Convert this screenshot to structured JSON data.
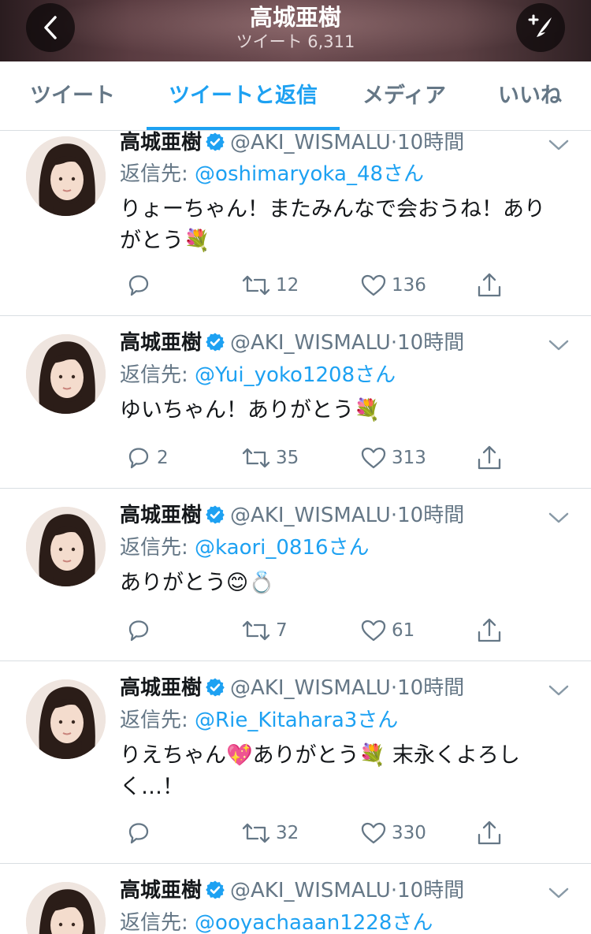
{
  "header": {
    "title": "高城亜樹",
    "tweet_count": "ツイート 6,311",
    "back_icon": "chevron-left-icon",
    "compose_icon": "compose-feather-icon"
  },
  "tabs": [
    {
      "label": "ツイート",
      "active": false
    },
    {
      "label": "ツイートと返信",
      "active": true
    },
    {
      "label": "メディア",
      "active": false
    },
    {
      "label": "いいね",
      "active": false
    }
  ],
  "colors": {
    "accent": "#1da1f2",
    "text": "#14171a",
    "muted": "#657786",
    "divider": "#d9dee2"
  },
  "tweets": [
    {
      "name": "高城亜樹",
      "handle": "@AKI_WISMALU",
      "dot": "·",
      "time": "10時間",
      "reply_prefix": "返信先: ",
      "reply_mention": "@oshimaryoka_48さん",
      "text_line1": "りょーちゃん！またみんなで会おうね！あり",
      "text_line2": "がとう",
      "emoji_end": "💐",
      "reply_count": "",
      "retweet_count": "12",
      "like_count": "136"
    },
    {
      "name": "高城亜樹",
      "handle": "@AKI_WISMALU",
      "dot": "·",
      "time": "10時間",
      "reply_prefix": "返信先: ",
      "reply_mention": "@Yui_yoko1208さん",
      "text_line1": "ゆいちゃん！ありがとう",
      "emoji_end": "💐",
      "reply_count": "2",
      "retweet_count": "35",
      "like_count": "313"
    },
    {
      "name": "高城亜樹",
      "handle": "@AKI_WISMALU",
      "dot": "·",
      "time": "10時間",
      "reply_prefix": "返信先: ",
      "reply_mention": "@kaori_0816さん",
      "text_line1": "ありがとう",
      "emoji_a": "😊",
      "emoji_b": "💍",
      "reply_count": "",
      "retweet_count": "7",
      "like_count": "61"
    },
    {
      "name": "高城亜樹",
      "handle": "@AKI_WISMALU",
      "dot": "·",
      "time": "10時間",
      "reply_prefix": "返信先: ",
      "reply_mention": "@Rie_Kitahara3さん",
      "text_a": "りえちゃん",
      "emoji_a": "💖",
      "text_b": "ありがとう",
      "emoji_b": "💐",
      "text_c": " 末永くよろし",
      "text_line2": "く…！",
      "reply_count": "",
      "retweet_count": "32",
      "like_count": "330"
    },
    {
      "name": "高城亜樹",
      "handle": "@AKI_WISMALU",
      "dot": "·",
      "time": "10時間",
      "reply_prefix": "返信先: ",
      "reply_mention": "@ooyachaaan1228さん"
    }
  ]
}
